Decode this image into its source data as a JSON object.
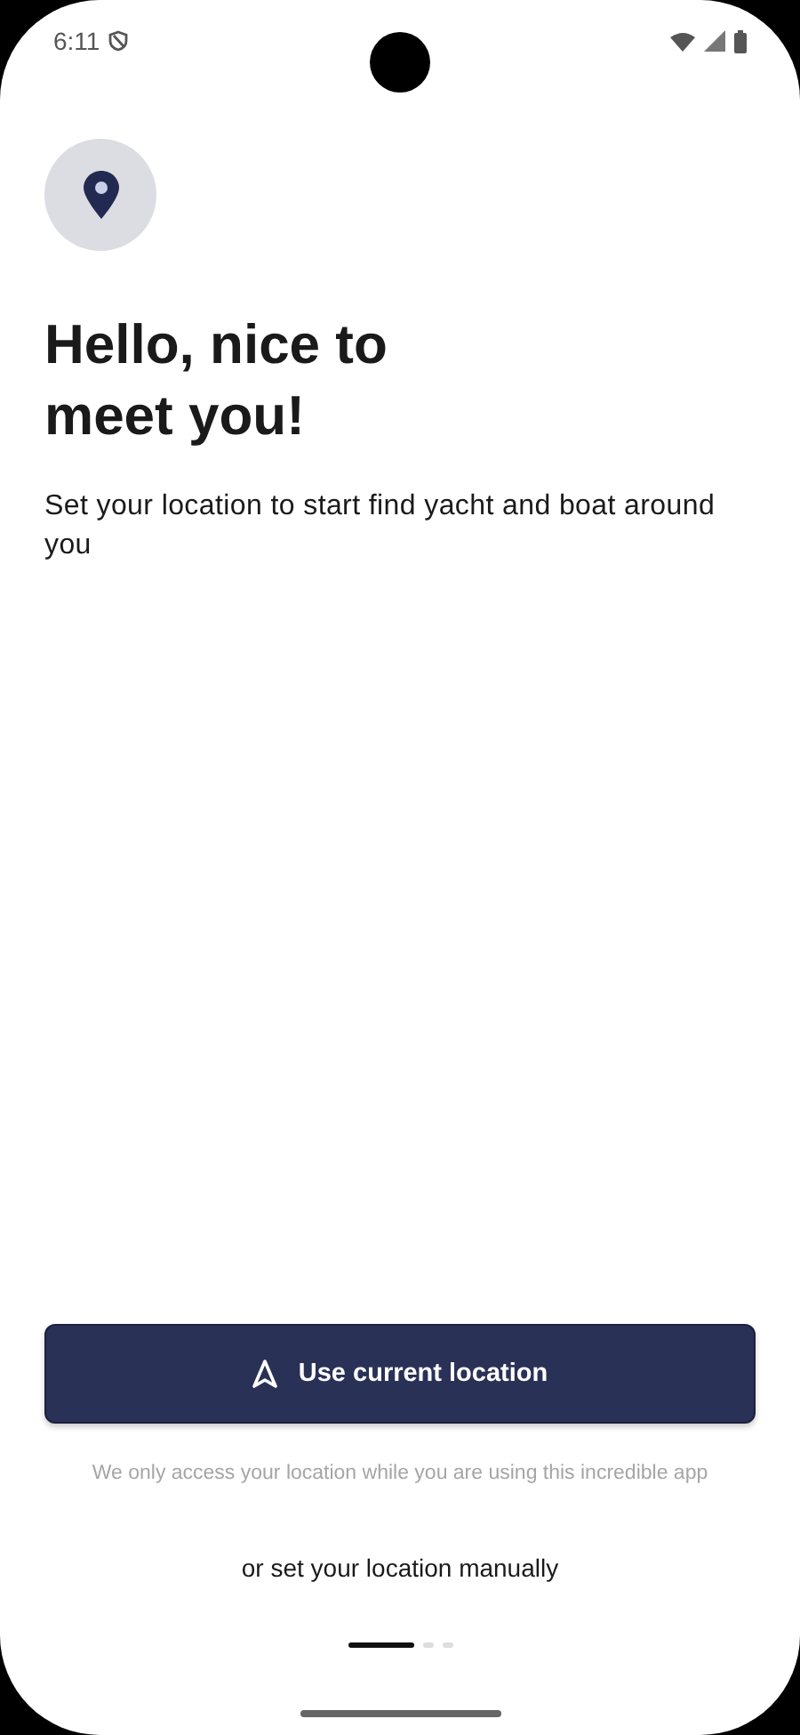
{
  "status_bar": {
    "time": "6:11"
  },
  "title": "Hello, nice to meet you!",
  "subtitle": "Set your location to start find yacht and boat around you",
  "primary_button": {
    "label": "Use current location"
  },
  "note": "We only access your location while you are using this incredible app",
  "manual_link": "or set your location manually",
  "pages": [
    {
      "selected": true
    },
    {
      "selected": false
    },
    {
      "selected": false
    }
  ]
}
